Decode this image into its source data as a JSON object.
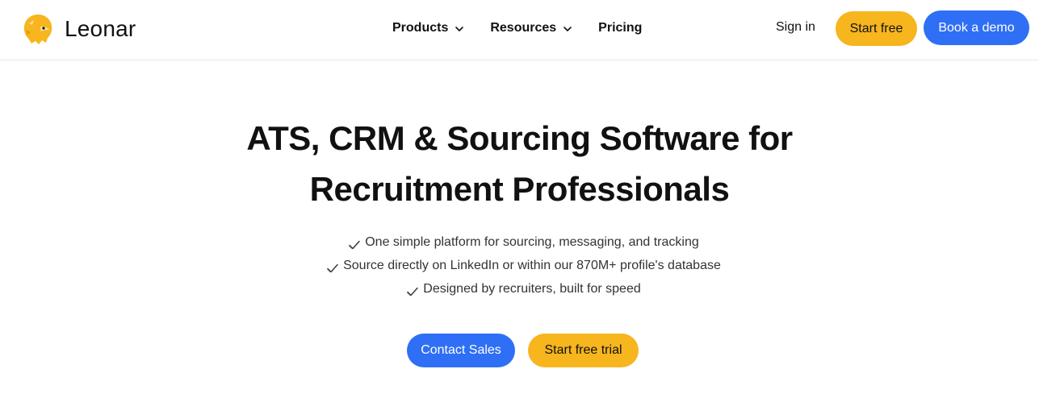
{
  "brand": {
    "name": "Leonar",
    "logo_icon": "lion-head-icon",
    "accent": "#f7b51e",
    "primary": "#2f6ff5"
  },
  "nav": {
    "products": "Products",
    "resources": "Resources",
    "pricing": "Pricing"
  },
  "header_actions": {
    "sign_in": "Sign in",
    "start_free": "Start free",
    "book_demo": "Book a demo"
  },
  "hero": {
    "title_line1": "ATS, CRM & Sourcing Software for",
    "title_line2": "Recruitment Professionals",
    "features": [
      "One simple platform for sourcing, messaging, and tracking",
      "Source directly on LinkedIn or within our 870M+ profile's database",
      "Designed by recruiters, built for speed"
    ],
    "contact_sales": "Contact Sales",
    "start_trial": "Start free trial"
  }
}
